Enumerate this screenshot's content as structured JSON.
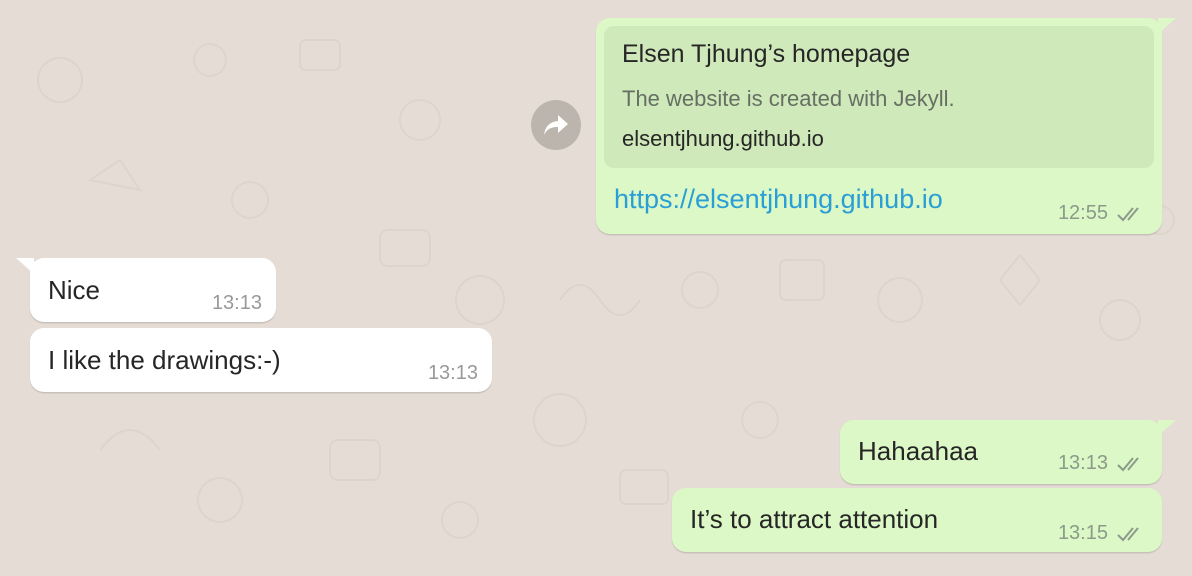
{
  "colors": {
    "background": "#e5ddd5",
    "outgoing_bubble": "#dcf8c6",
    "incoming_bubble": "#ffffff",
    "link": "#2a9fd6"
  },
  "forward_icon": "forward-arrow-icon",
  "messages": [
    {
      "direction": "outgoing",
      "preview": {
        "title": "Elsen Tjhung’s homepage",
        "description": "The website is created with Jekyll.",
        "domain": "elsentjhung.github.io"
      },
      "text": "https://elsentjhung.github.io",
      "time": "12:55",
      "status_icon": "double-check-icon"
    },
    {
      "direction": "incoming",
      "text": "Nice",
      "time": "13:13"
    },
    {
      "direction": "incoming",
      "text": "I like the drawings:-)",
      "time": "13:13"
    },
    {
      "direction": "outgoing",
      "text": "Hahaahaa",
      "time": "13:13",
      "status_icon": "double-check-icon"
    },
    {
      "direction": "outgoing",
      "text": "It’s to attract attention",
      "time": "13:15",
      "status_icon": "double-check-icon"
    }
  ]
}
